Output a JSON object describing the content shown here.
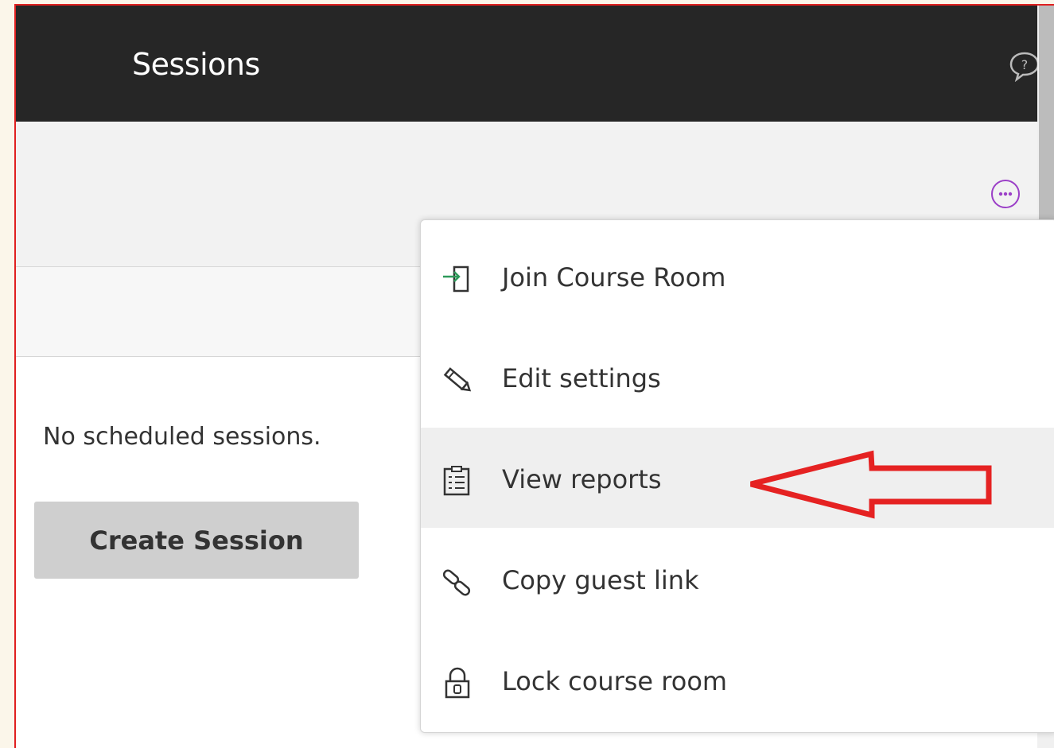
{
  "header": {
    "title": "Sessions",
    "help_icon": "help-chat-icon",
    "more_icon": "more-options-icon"
  },
  "main": {
    "empty_text": "No scheduled sessions.",
    "create_button_label": "Create Session"
  },
  "menu": {
    "items": [
      {
        "label": "Join Course Room",
        "icon": "join-icon"
      },
      {
        "label": "Edit settings",
        "icon": "pencil-icon"
      },
      {
        "label": "View reports",
        "icon": "report-icon"
      },
      {
        "label": "Copy guest link",
        "icon": "link-icon"
      },
      {
        "label": "Lock course room",
        "icon": "lock-icon"
      }
    ],
    "highlighted_item": "View reports"
  },
  "annotation": {
    "arrow_icon": "red-arrow-annotation",
    "color": "#e52222"
  },
  "colors": {
    "header_bg": "#262626",
    "accent_purple": "#9b3fc7",
    "join_green": "#2e9a5a"
  }
}
